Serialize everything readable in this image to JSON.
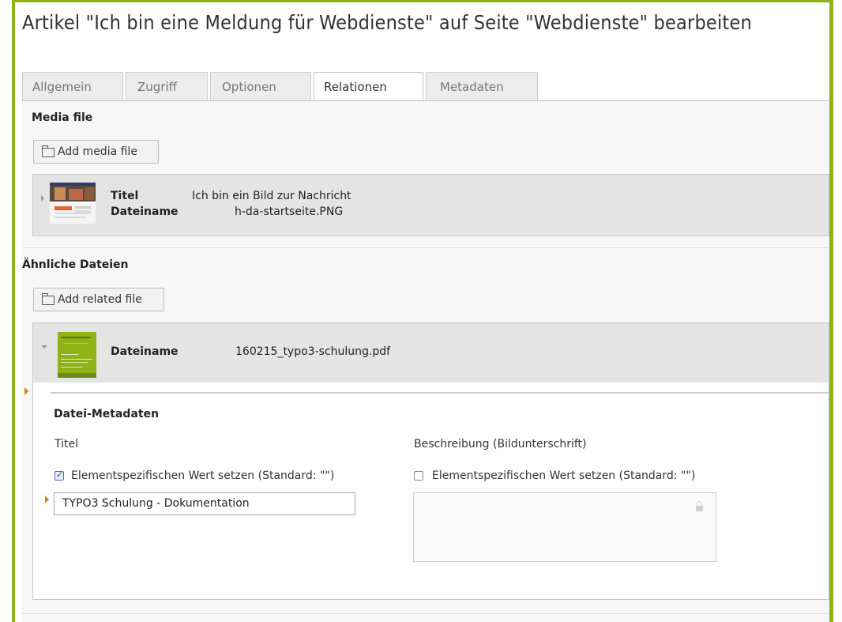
{
  "title": "Artikel \"Ich bin eine Meldung für Webdienste\" auf Seite \"Webdienste\" bearbeiten",
  "tabs": [
    {
      "label": "Allgemein"
    },
    {
      "label": "Zugriff"
    },
    {
      "label": "Optionen"
    },
    {
      "label": "Relationen"
    },
    {
      "label": "Metadaten"
    }
  ],
  "active_tab": "Relationen",
  "media": {
    "section_title": "Media file",
    "add_button": "Add media file",
    "record": {
      "title_label": "Titel",
      "title_value": "Ich bin ein Bild zur Nachricht",
      "filename_label": "Dateiname",
      "filename_value": "h-da-startseite.PNG"
    }
  },
  "related": {
    "section_title": "Ähnliche Dateien",
    "add_button": "Add related file",
    "record": {
      "filename_label": "Dateiname",
      "filename_value": "160215_typo3-schulung.pdf"
    },
    "metadata": {
      "heading": "Datei-Metadaten",
      "title_field": {
        "label": "Titel",
        "override_label": "Elementspezifischen Wert setzen (Standard: \"\")",
        "override_checked": true,
        "value": "TYPO3 Schulung - Dokumentation"
      },
      "description_field": {
        "label": "Beschreibung (Bildunterschrift)",
        "override_label": "Elementspezifischen Wert setzen (Standard: \"\")",
        "override_checked": false,
        "value": ""
      }
    }
  },
  "colors": {
    "frame": "#8fb216",
    "marker": "#c88a1a"
  },
  "icons": [
    "folder-icon",
    "expand-caret-icon",
    "collapse-caret-icon",
    "lock-icon",
    "checkbox-icon"
  ]
}
